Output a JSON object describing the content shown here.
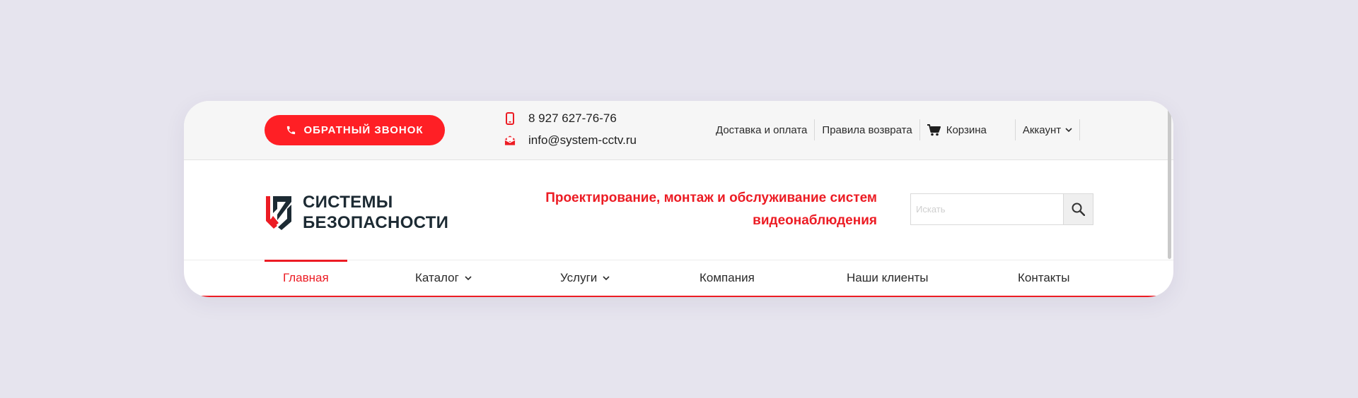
{
  "topbar": {
    "callback_label": "ОБРАТНЫЙ ЗВОНОК",
    "phone": "8 927 627-76-76",
    "email": "info@system-cctv.ru",
    "links": {
      "delivery": "Доставка и оплата",
      "returns": "Правила возврата",
      "cart": "Корзина",
      "account": "Аккаунт"
    }
  },
  "logo": {
    "line1": "СИСТЕМЫ",
    "line2": "БЕЗОПАСНОСТИ"
  },
  "slogan": {
    "line1": "Проектирование, монтаж и обслуживание систем",
    "line2": "видеонаблюдения"
  },
  "search": {
    "placeholder": "Искать"
  },
  "nav": {
    "items": [
      {
        "label": "Главная"
      },
      {
        "label": "Каталог"
      },
      {
        "label": "Услуги"
      },
      {
        "label": "Компания"
      },
      {
        "label": "Наши клиенты"
      },
      {
        "label": "Контакты"
      }
    ],
    "active_index": 0
  },
  "colors": {
    "accent": "#ec1c24",
    "button": "#ff1f25",
    "background": "#e6e4ee",
    "topbar": "#f6f6f6",
    "logo_dark": "#1c2a33"
  },
  "icons": {
    "callback": "phone-icon",
    "phone": "mobile-phone-icon",
    "email": "envelope-icon",
    "cart": "cart-icon",
    "account": "chevron-down-icon",
    "search": "search-icon"
  }
}
